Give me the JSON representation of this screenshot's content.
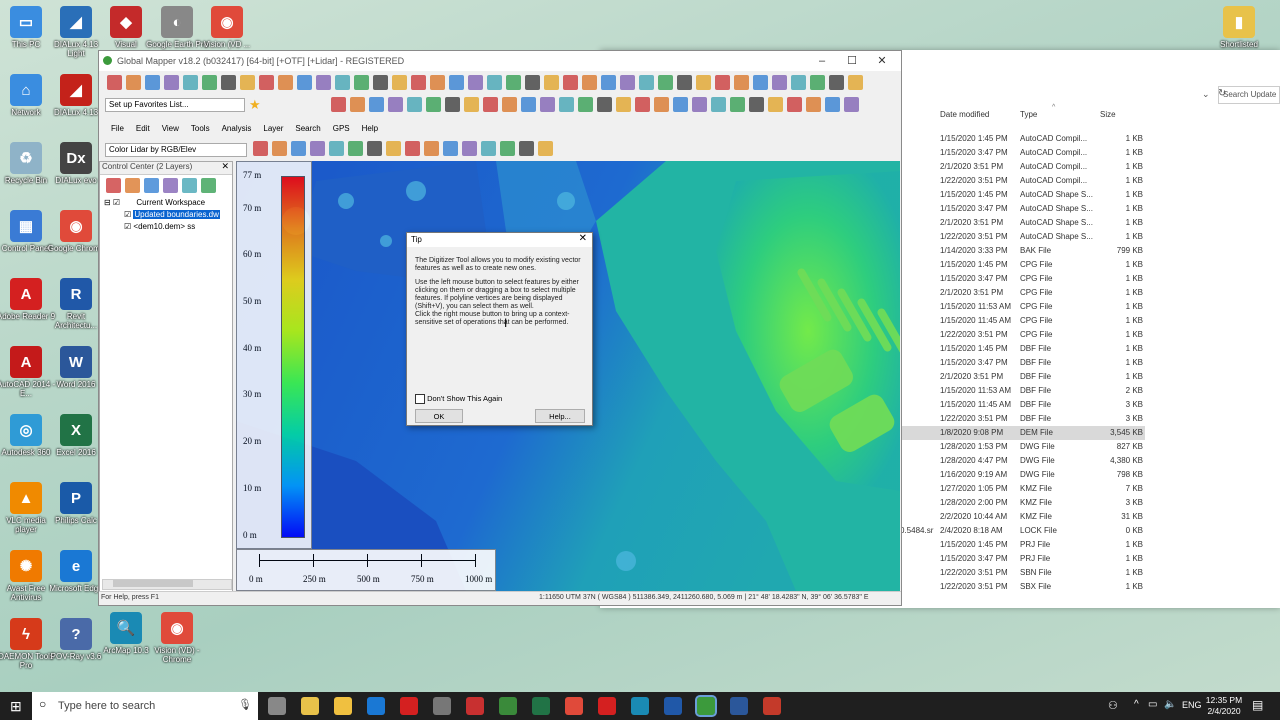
{
  "desktop_icons": [
    {
      "label": "This PC",
      "color": "#3a8de0",
      "glyph": "▭"
    },
    {
      "label": "Network",
      "color": "#3a8de0",
      "glyph": "⌂"
    },
    {
      "label": "Recycle Bin",
      "color": "#8fb3c8",
      "glyph": "♻"
    },
    {
      "label": "Control Panel",
      "color": "#3a7bd5",
      "glyph": "▦"
    },
    {
      "label": "Adobe Reader 9",
      "color": "#d42020",
      "glyph": "A"
    },
    {
      "label": "AutoCAD 2014 - E...",
      "color": "#c41a1a",
      "glyph": "A"
    },
    {
      "label": "Autodesk 360",
      "color": "#2f9bd6",
      "glyph": "◎"
    },
    {
      "label": "VLC media player",
      "color": "#f08a00",
      "glyph": "▲"
    },
    {
      "label": "Avast Free Antivirus",
      "color": "#f07a00",
      "glyph": "✺"
    },
    {
      "label": "DAEMON Tools Pro",
      "color": "#d63a1a",
      "glyph": "ϟ"
    }
  ],
  "desktop_icons_col2": [
    {
      "label": "DIALux 4.13 Light",
      "color": "#2a6fb8",
      "glyph": "◢"
    },
    {
      "label": "DIALux 4.13",
      "color": "#c4221a",
      "glyph": "◢"
    },
    {
      "label": "DIALux evo",
      "color": "#444",
      "glyph": "Dx"
    },
    {
      "label": "Google Chrome",
      "color": "#e04a3a",
      "glyph": "◉"
    },
    {
      "label": "Revit Architectu...",
      "color": "#2058a8",
      "glyph": "R"
    },
    {
      "label": "Word 2016",
      "color": "#2b579a",
      "glyph": "W"
    },
    {
      "label": "Excel 2016",
      "color": "#217346",
      "glyph": "X"
    },
    {
      "label": "Philips Calc",
      "color": "#1a5aa8",
      "glyph": "P"
    },
    {
      "label": "Microsoft Edge",
      "color": "#1a78d4",
      "glyph": "e"
    },
    {
      "label": "POV-Ray v3.6",
      "color": "#4a6aa8",
      "glyph": "?"
    }
  ],
  "desktop_icons_col3": [
    {
      "label": "Visual",
      "color": "#c42a2a",
      "glyph": "◆"
    },
    {
      "label": "ArcMap 10.3",
      "color": "#1a8ab4",
      "glyph": "🔍"
    }
  ],
  "desktop_icons_col4": [
    {
      "label": "Google Earth Pro",
      "color": "#888",
      "glyph": "◐"
    },
    {
      "label": "Vision (VD) - Chrome",
      "color": "#e04a3a",
      "glyph": "◉"
    }
  ],
  "desktop_icons_col5": [
    {
      "label": "Vision (VD ...",
      "color": "#e04a3a",
      "glyph": "◉"
    }
  ],
  "desktop_top_right": {
    "label": "Shortlisted",
    "color": "#e8c24a",
    "glyph": "▮"
  },
  "explorer": {
    "search_placeholder": "Search Update",
    "col_date": "Date modified",
    "col_type": "Type",
    "col_size": "Size",
    "rows": [
      {
        "date": "1/15/2020 1:45 PM",
        "type": "AutoCAD Compil...",
        "size": "1 KB"
      },
      {
        "date": "1/15/2020 3:47 PM",
        "type": "AutoCAD Compil...",
        "size": "1 KB"
      },
      {
        "date": "2/1/2020 3:51 PM",
        "type": "AutoCAD Compil...",
        "size": "1 KB"
      },
      {
        "date": "1/22/2020 3:51 PM",
        "type": "AutoCAD Compil...",
        "size": "1 KB"
      },
      {
        "date": "1/15/2020 1:45 PM",
        "type": "AutoCAD Shape S...",
        "size": "1 KB"
      },
      {
        "date": "1/15/2020 3:47 PM",
        "type": "AutoCAD Shape S...",
        "size": "1 KB"
      },
      {
        "date": "2/1/2020 3:51 PM",
        "type": "AutoCAD Shape S...",
        "size": "1 KB"
      },
      {
        "date": "1/22/2020 3:51 PM",
        "type": "AutoCAD Shape S...",
        "size": "1 KB"
      },
      {
        "date": "1/14/2020 3:33 PM",
        "type": "BAK File",
        "size": "799 KB"
      },
      {
        "date": "1/15/2020 1:45 PM",
        "type": "CPG File",
        "size": "1 KB"
      },
      {
        "date": "1/15/2020 3:47 PM",
        "type": "CPG File",
        "size": "1 KB"
      },
      {
        "date": "2/1/2020 3:51 PM",
        "type": "CPG File",
        "size": "1 KB"
      },
      {
        "date": "1/15/2020 11:53 AM",
        "type": "CPG File",
        "size": "1 KB"
      },
      {
        "date": "1/15/2020 11:45 AM",
        "type": "CPG File",
        "size": "1 KB"
      },
      {
        "date": "1/22/2020 3:51 PM",
        "type": "CPG File",
        "size": "1 KB"
      },
      {
        "date": "1/15/2020 1:45 PM",
        "type": "DBF File",
        "size": "1 KB"
      },
      {
        "date": "1/15/2020 3:47 PM",
        "type": "DBF File",
        "size": "1 KB"
      },
      {
        "date": "2/1/2020 3:51 PM",
        "type": "DBF File",
        "size": "1 KB"
      },
      {
        "date": "1/15/2020 11:53 AM",
        "type": "DBF File",
        "size": "2 KB"
      },
      {
        "date": "1/15/2020 11:45 AM",
        "type": "DBF File",
        "size": "3 KB"
      },
      {
        "date": "1/22/2020 3:51 PM",
        "type": "DBF File",
        "size": "3 KB"
      },
      {
        "date": "1/8/2020 9:08 PM",
        "type": "DEM File",
        "size": "3,545 KB"
      },
      {
        "date": "1/28/2020 1:53 PM",
        "type": "DWG File",
        "size": "827 KB"
      },
      {
        "date": "1/28/2020 4:47 PM",
        "type": "DWG File",
        "size": "4,380 KB"
      },
      {
        "date": "1/16/2020 9:19 AM",
        "type": "DWG File",
        "size": "798 KB"
      },
      {
        "date": "1/27/2020 1:05 PM",
        "type": "KMZ File",
        "size": "7 KB"
      },
      {
        "date": "1/28/2020 2:00 PM",
        "type": "KMZ File",
        "size": "3 KB"
      },
      {
        "date": "2/2/2020 10:44 AM",
        "type": "KMZ File",
        "size": "31 KB"
      },
      {
        "date": "2/4/2020 8:18 AM",
        "type": "LOCK File",
        "size": "0 KB"
      },
      {
        "date": "1/15/2020 1:45 PM",
        "type": "PRJ File",
        "size": "1 KB"
      },
      {
        "date": "1/15/2020 3:47 PM",
        "type": "PRJ File",
        "size": "1 KB"
      },
      {
        "date": "1/22/2020 3:51 PM",
        "type": "SBN File",
        "size": "1 KB"
      },
      {
        "date": "1/22/2020 3:51 PM",
        "type": "SBX File",
        "size": "1 KB"
      }
    ],
    "lock_name_fragment": "0.5484.sr",
    "selected_index": 21
  },
  "gm": {
    "title": "Global Mapper v18.2 (b032417) [64-bit] [+OTF] [+Lidar] - REGISTERED",
    "favorites": "Set up Favorites List...",
    "menu": [
      "File",
      "Edit",
      "View",
      "Tools",
      "Analysis",
      "Layer",
      "Search",
      "GPS",
      "Help"
    ],
    "lidar_combo": "Color Lidar by RGB/Elev",
    "control_center": "Control Center (2 Layers)",
    "workspace": "Current Workspace",
    "layer1": "Updated boundaries.dw",
    "layer2": "<dem10.dem> ss",
    "status_help": "For Help, press F1",
    "status_coords": "1:11650  UTM 37N ( WGS84 ) 511386.349, 2411260.680, 5.069 m | 21° 48' 18.4283\" N, 39° 06' 36.5783\" E",
    "legend_labels": [
      "77 m",
      "70 m",
      "60 m",
      "50 m",
      "40 m",
      "30 m",
      "20 m",
      "10 m",
      "0 m"
    ],
    "scale_labels": [
      "0 m",
      "250 m",
      "500 m",
      "750 m",
      "1000 m"
    ]
  },
  "tip": {
    "title": "Tip",
    "para1": "The Digitizer Tool allows you to modify existing vector features as well as to create new ones.",
    "para2": "Use the left mouse button to select features by either clicking on them or dragging a box to select multiple features. If polyline vertices are being displayed (Shift+V), you can select them as well.",
    "para3": "Click the right mouse button to bring up a context-sensitive set of operations that can be performed.",
    "checkbox": "Don't Show This Again",
    "ok": "OK",
    "help": "Help..."
  },
  "taskbar": {
    "search_placeholder": "Type here to search",
    "lang": "ENG",
    "time": "12:35 PM",
    "date": "2/4/2020"
  }
}
